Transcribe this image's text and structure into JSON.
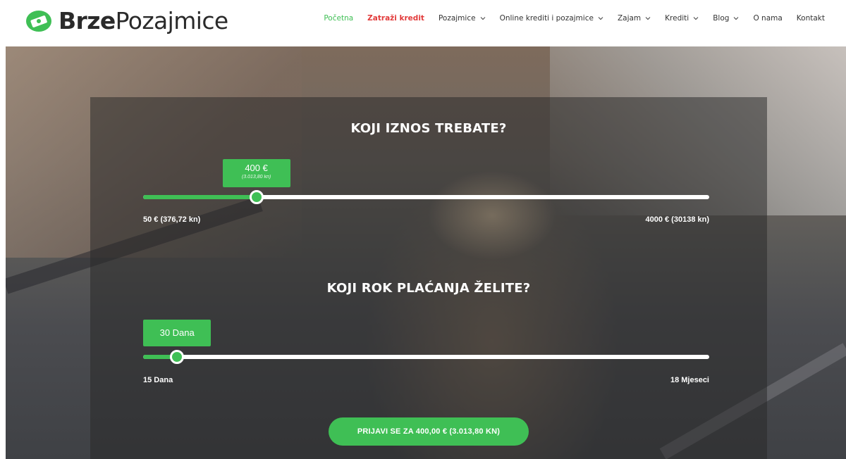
{
  "brand": {
    "name_bold": "Brze",
    "name_light": "Pozajmice",
    "icon": "money-bill-leaf-logo-icon",
    "accent_color": "#3fbf55"
  },
  "nav": {
    "items": [
      {
        "label": "Početna",
        "state": "active",
        "has_dropdown": false
      },
      {
        "label": "Zatraži kredit",
        "state": "highlight",
        "has_dropdown": false
      },
      {
        "label": "Pozajmice",
        "state": "normal",
        "has_dropdown": true
      },
      {
        "label": "Online krediti i pozajmice",
        "state": "normal",
        "has_dropdown": true
      },
      {
        "label": "Zajam",
        "state": "normal",
        "has_dropdown": true
      },
      {
        "label": "Krediti",
        "state": "normal",
        "has_dropdown": true
      },
      {
        "label": "Blog",
        "state": "normal",
        "has_dropdown": true
      },
      {
        "label": "O nama",
        "state": "normal",
        "has_dropdown": false
      },
      {
        "label": "Kontakt",
        "state": "normal",
        "has_dropdown": false
      }
    ],
    "chevron_icon": "chevron-down-icon",
    "active_color": "#3fbf55",
    "highlight_color": "#e23b3b"
  },
  "amount": {
    "title": "KOJI IZNOS TREBATE?",
    "value_label": "400 €",
    "value_sub": "(3.013,80 kn)",
    "value_fraction": 0.2,
    "min_label": "50 € (376,72 kn)",
    "max_label": "4000 € (30138 kn)"
  },
  "term": {
    "title": "KOJI ROK PLAĆANJA ŽELITE?",
    "value_label": "30 Dana",
    "value_fraction": 0.06,
    "min_label": "15 Dana",
    "max_label": "18 Mjeseci"
  },
  "cta": {
    "label": "PRIJAVI SE ZA 400,00 € (3.013,80 KN)"
  }
}
